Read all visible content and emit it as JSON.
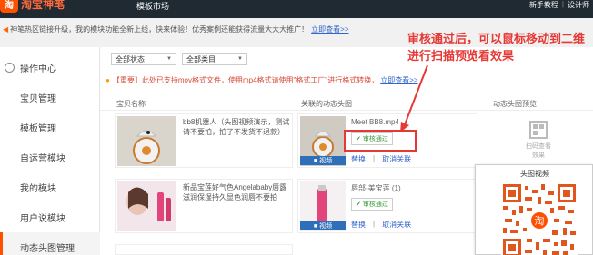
{
  "topbar": {
    "logo_text": "淘宝神笔",
    "nav": "模板市场",
    "right_links": [
      "新手教程",
      "设计师"
    ]
  },
  "notice": {
    "text": "神笔热区链接升级，我的模块功能全新上线，快来体验！优秀案例还能获得流量大大大推广！",
    "link": "立即查看>>"
  },
  "sidebar": {
    "items": [
      {
        "label": "操作中心"
      },
      {
        "label": "宝贝管理"
      },
      {
        "label": "模板管理"
      },
      {
        "label": "自运营模块"
      },
      {
        "label": "我的模块"
      },
      {
        "label": "用户说模块"
      },
      {
        "label": "动态头图管理"
      }
    ]
  },
  "filters": {
    "status": "全部状态",
    "category": "全部类目"
  },
  "tip": {
    "text": "【重要】此处已支持mov格式文件，使用mp4格式请使用\"格式工厂\"进行格式转换，",
    "link": "立即查看>>"
  },
  "table": {
    "headers": [
      "宝贝名称",
      "关联的动态头图",
      "动态头图预览"
    ]
  },
  "rows": [
    {
      "desc": "bb8机器人（头图视频演示，测试请不要拍，拍了不发货不退款）",
      "video_name": "Meet BB8.mp4",
      "status": "审核通过",
      "badge": "视频",
      "actions": [
        "替换",
        "取消关联"
      ]
    },
    {
      "desc": "新品宝莲好气色Angelababy唇露 滋润保湿持久显色润唇不要拍",
      "video_name": "唇部-美宝莲 (1)",
      "status": "审核通过",
      "badge": "视频",
      "actions": [
        "替换",
        "取消关联"
      ]
    }
  ],
  "annotation": {
    "line1": "审核通过后，可以鼠标移动到二维",
    "line2": "进行扫描预览看效果"
  },
  "preview": {
    "label": "扫码查看效果",
    "popup_title": "头图视频"
  },
  "colors": {
    "topbar": "#1f2a33",
    "brand": "#ff5000",
    "link": "#3366cc",
    "annotation": "#e53935"
  }
}
